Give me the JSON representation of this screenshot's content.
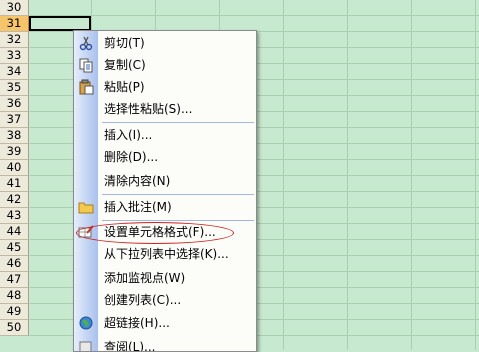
{
  "rows": [
    "30",
    "31",
    "32",
    "33",
    "34",
    "35",
    "36",
    "37",
    "38",
    "39",
    "40",
    "41",
    "42",
    "43",
    "44",
    "45",
    "46",
    "47",
    "48",
    "49",
    "50"
  ],
  "selected_row": "31",
  "menu": {
    "items": [
      {
        "label": "剪切(T)",
        "icon": "scissors-icon"
      },
      {
        "label": "复制(C)",
        "icon": "copy-icon"
      },
      {
        "label": "粘贴(P)",
        "icon": "paste-icon"
      },
      {
        "label": "选择性粘贴(S)...",
        "icon": ""
      },
      {
        "label": "插入(I)...",
        "icon": ""
      },
      {
        "label": "删除(D)...",
        "icon": ""
      },
      {
        "label": "清除内容(N)",
        "icon": ""
      },
      {
        "label": "插入批注(M)",
        "icon": "comment-folder-icon"
      },
      {
        "label": "设置单元格格式(F)...",
        "icon": "format-cells-icon"
      },
      {
        "label": "从下拉列表中选择(K)...",
        "icon": ""
      },
      {
        "label": "添加监视点(W)",
        "icon": ""
      },
      {
        "label": "创建列表(C)...",
        "icon": ""
      },
      {
        "label": "超链接(H)...",
        "icon": "hyperlink-globe-icon"
      },
      {
        "label": "查阅(L)...",
        "icon": "lookup-icon"
      }
    ]
  },
  "colors": {
    "annotation_ellipse": "#cc2020",
    "sheet_bg": "#c7e9cf",
    "selected_row_header": "#f6c46a"
  }
}
